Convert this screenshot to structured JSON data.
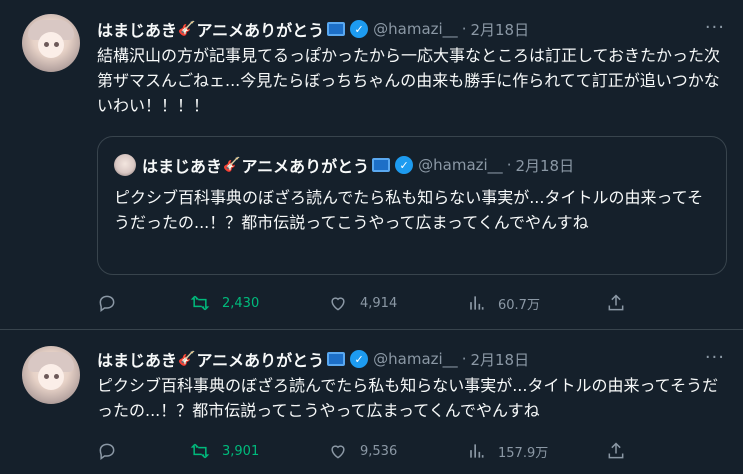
{
  "tweets": [
    {
      "author": {
        "name": "はまじあき",
        "name_emoji": "🎸",
        "name_suffix": "アニメありがとう",
        "handle": "@hamazi__",
        "date": "2月18日"
      },
      "text": "結構沢山の方が記事見てるっぽかったから一応大事なところは訂正しておきたかった次第ザマスんごねェ...今見たらぼっちちゃんの由来も勝手に作られてて訂正が追いつかないわい！！！！",
      "quote": {
        "author": {
          "name": "はまじあき",
          "name_emoji": "🎸",
          "name_suffix": "アニメありがとう",
          "handle": "@hamazi__",
          "date": "2月18日"
        },
        "text": "ピクシブ百科事典のぼざろ読んでたら私も知らない事実が...タイトルの由来ってそうだったの...！？都市伝説ってこうやって広まってくんでやんすね"
      },
      "stats": {
        "replies": "",
        "retweets": "2,430",
        "likes": "4,914",
        "views": "60.7万"
      }
    },
    {
      "author": {
        "name": "はまじあき",
        "name_emoji": "🎸",
        "name_suffix": "アニメありがとう",
        "handle": "@hamazi__",
        "date": "2月18日"
      },
      "text": "ピクシブ百科事典のぼざろ読んでたら私も知らない事実が...タイトルの由来ってそうだったの...！？都市伝説ってこうやって広まってくんでやんすね",
      "stats": {
        "replies": "",
        "retweets": "3,901",
        "likes": "9,536",
        "views": "157.9万"
      }
    }
  ],
  "ui": {
    "separator": "·",
    "more_glyph": "···",
    "verified_glyph": "✓"
  },
  "colors": {
    "background": "#15202b",
    "border": "#38444d",
    "muted": "#8b98a5",
    "verified": "#1d9bf0",
    "retweet_active": "#00ba7c"
  },
  "icons": [
    "reply-icon",
    "retweet-icon",
    "like-icon",
    "views-icon",
    "share-icon",
    "verified-badge-icon",
    "tv-emoji-icon",
    "more-icon"
  ]
}
